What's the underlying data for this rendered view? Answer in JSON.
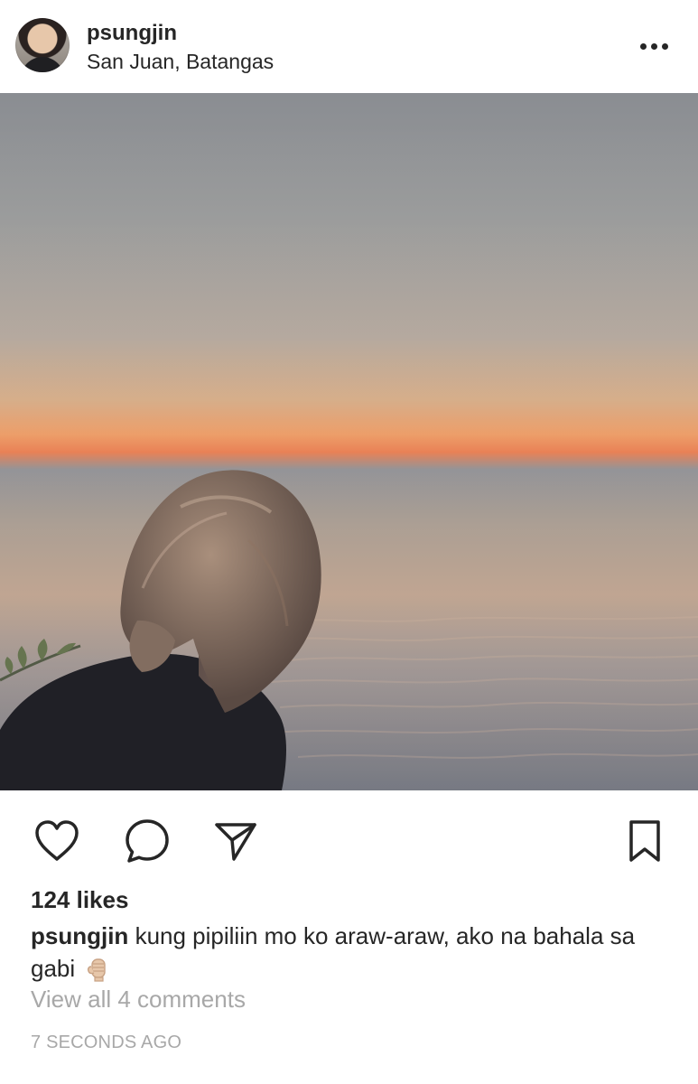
{
  "post": {
    "username": "psungjin",
    "location": "San Juan, Batangas",
    "likes_text": "124 likes",
    "caption_username": "psungjin",
    "caption_text": "kung pipiliin mo ko araw-araw, ako na bahala sa gabi",
    "caption_emoji": "fist-emoji",
    "view_comments_text": "View all 4 comments",
    "timestamp": "7 SECONDS AGO"
  },
  "icons": {
    "more": "more-options-icon",
    "heart": "heart-icon",
    "comment": "comment-icon",
    "share": "send-icon",
    "save": "bookmark-icon"
  },
  "colors": {
    "text": "#262626",
    "muted_text": "#a8a8a8",
    "background": "#ffffff",
    "sky_top": "#8a8d92",
    "sunset_glow": "#ec9a63",
    "sea": "#a89a8e"
  }
}
